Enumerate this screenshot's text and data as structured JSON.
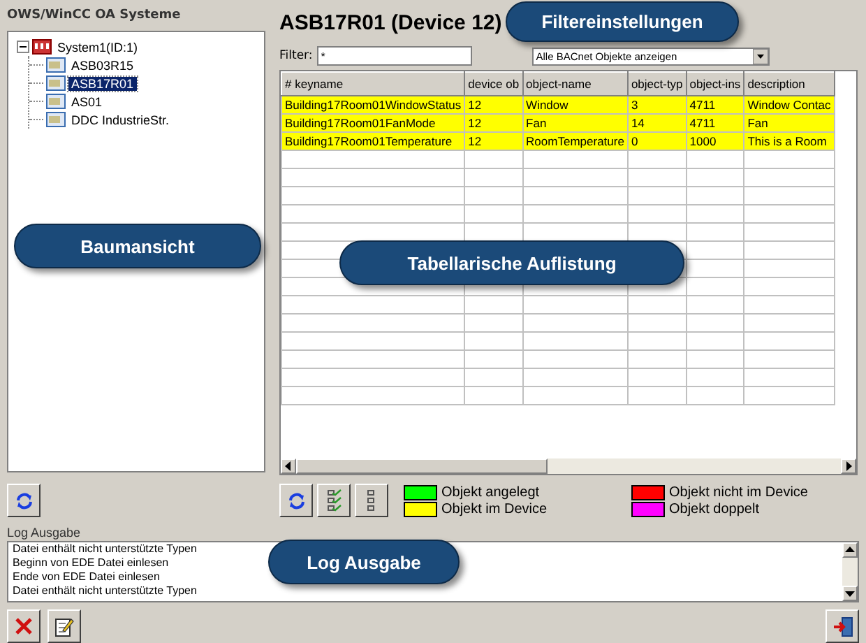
{
  "left_panel": {
    "title": "OWS/WinCC OA Systeme",
    "tree": [
      {
        "label": "System1(ID:1)",
        "expanded": true,
        "selected": false,
        "kind": "system",
        "children": [
          {
            "label": "ASB03R15",
            "selected": false,
            "kind": "device"
          },
          {
            "label": "ASB17R01",
            "selected": true,
            "kind": "device"
          },
          {
            "label": "AS01",
            "selected": false,
            "kind": "device"
          },
          {
            "label": "DDC IndustrieStr.",
            "selected": false,
            "kind": "device"
          }
        ]
      }
    ]
  },
  "device_title": "ASB17R01 (Device 12)",
  "filter": {
    "label": "Filter:",
    "value": "*",
    "dropdown": "Alle BACnet Objekte anzeigen"
  },
  "table": {
    "columns": [
      "# keyname",
      "device ob",
      "object-name",
      "object-typ",
      "object-ins",
      "description"
    ],
    "rows": [
      {
        "color": "#ffff00",
        "cells": [
          "Building17Room01WindowStatus",
          "12",
          "Window",
          "3",
          "4711",
          "Window Contac"
        ]
      },
      {
        "color": "#ffff00",
        "cells": [
          "Building17Room01FanMode",
          "12",
          "Fan",
          "14",
          "4711",
          "Fan"
        ]
      },
      {
        "color": "#ffff00",
        "cells": [
          "Building17Room01Temperature",
          "12",
          "RoomTemperature",
          "0",
          "1000",
          "This is a Room"
        ]
      }
    ]
  },
  "legend": [
    {
      "label": "Objekt angelegt",
      "color": "#00ff00"
    },
    {
      "label": "Objekt nicht im Device",
      "color": "#ff0000"
    },
    {
      "label": "Objekt im Device",
      "color": "#ffff00"
    },
    {
      "label": "Objekt doppelt",
      "color": "#ff00ff"
    }
  ],
  "log": {
    "title": "Log Ausgabe",
    "lines": [
      "Datei enthält nicht unterstützte Typen",
      "Beginn von  EDE Datei einlesen",
      "Ende von EDE Datei einlesen",
      "Datei enthält nicht unterstützte Typen"
    ]
  },
  "callouts": [
    "Filtereinstellungen",
    "Baumansicht",
    "Tabellarische Auflistung",
    "Log Ausgabe"
  ]
}
